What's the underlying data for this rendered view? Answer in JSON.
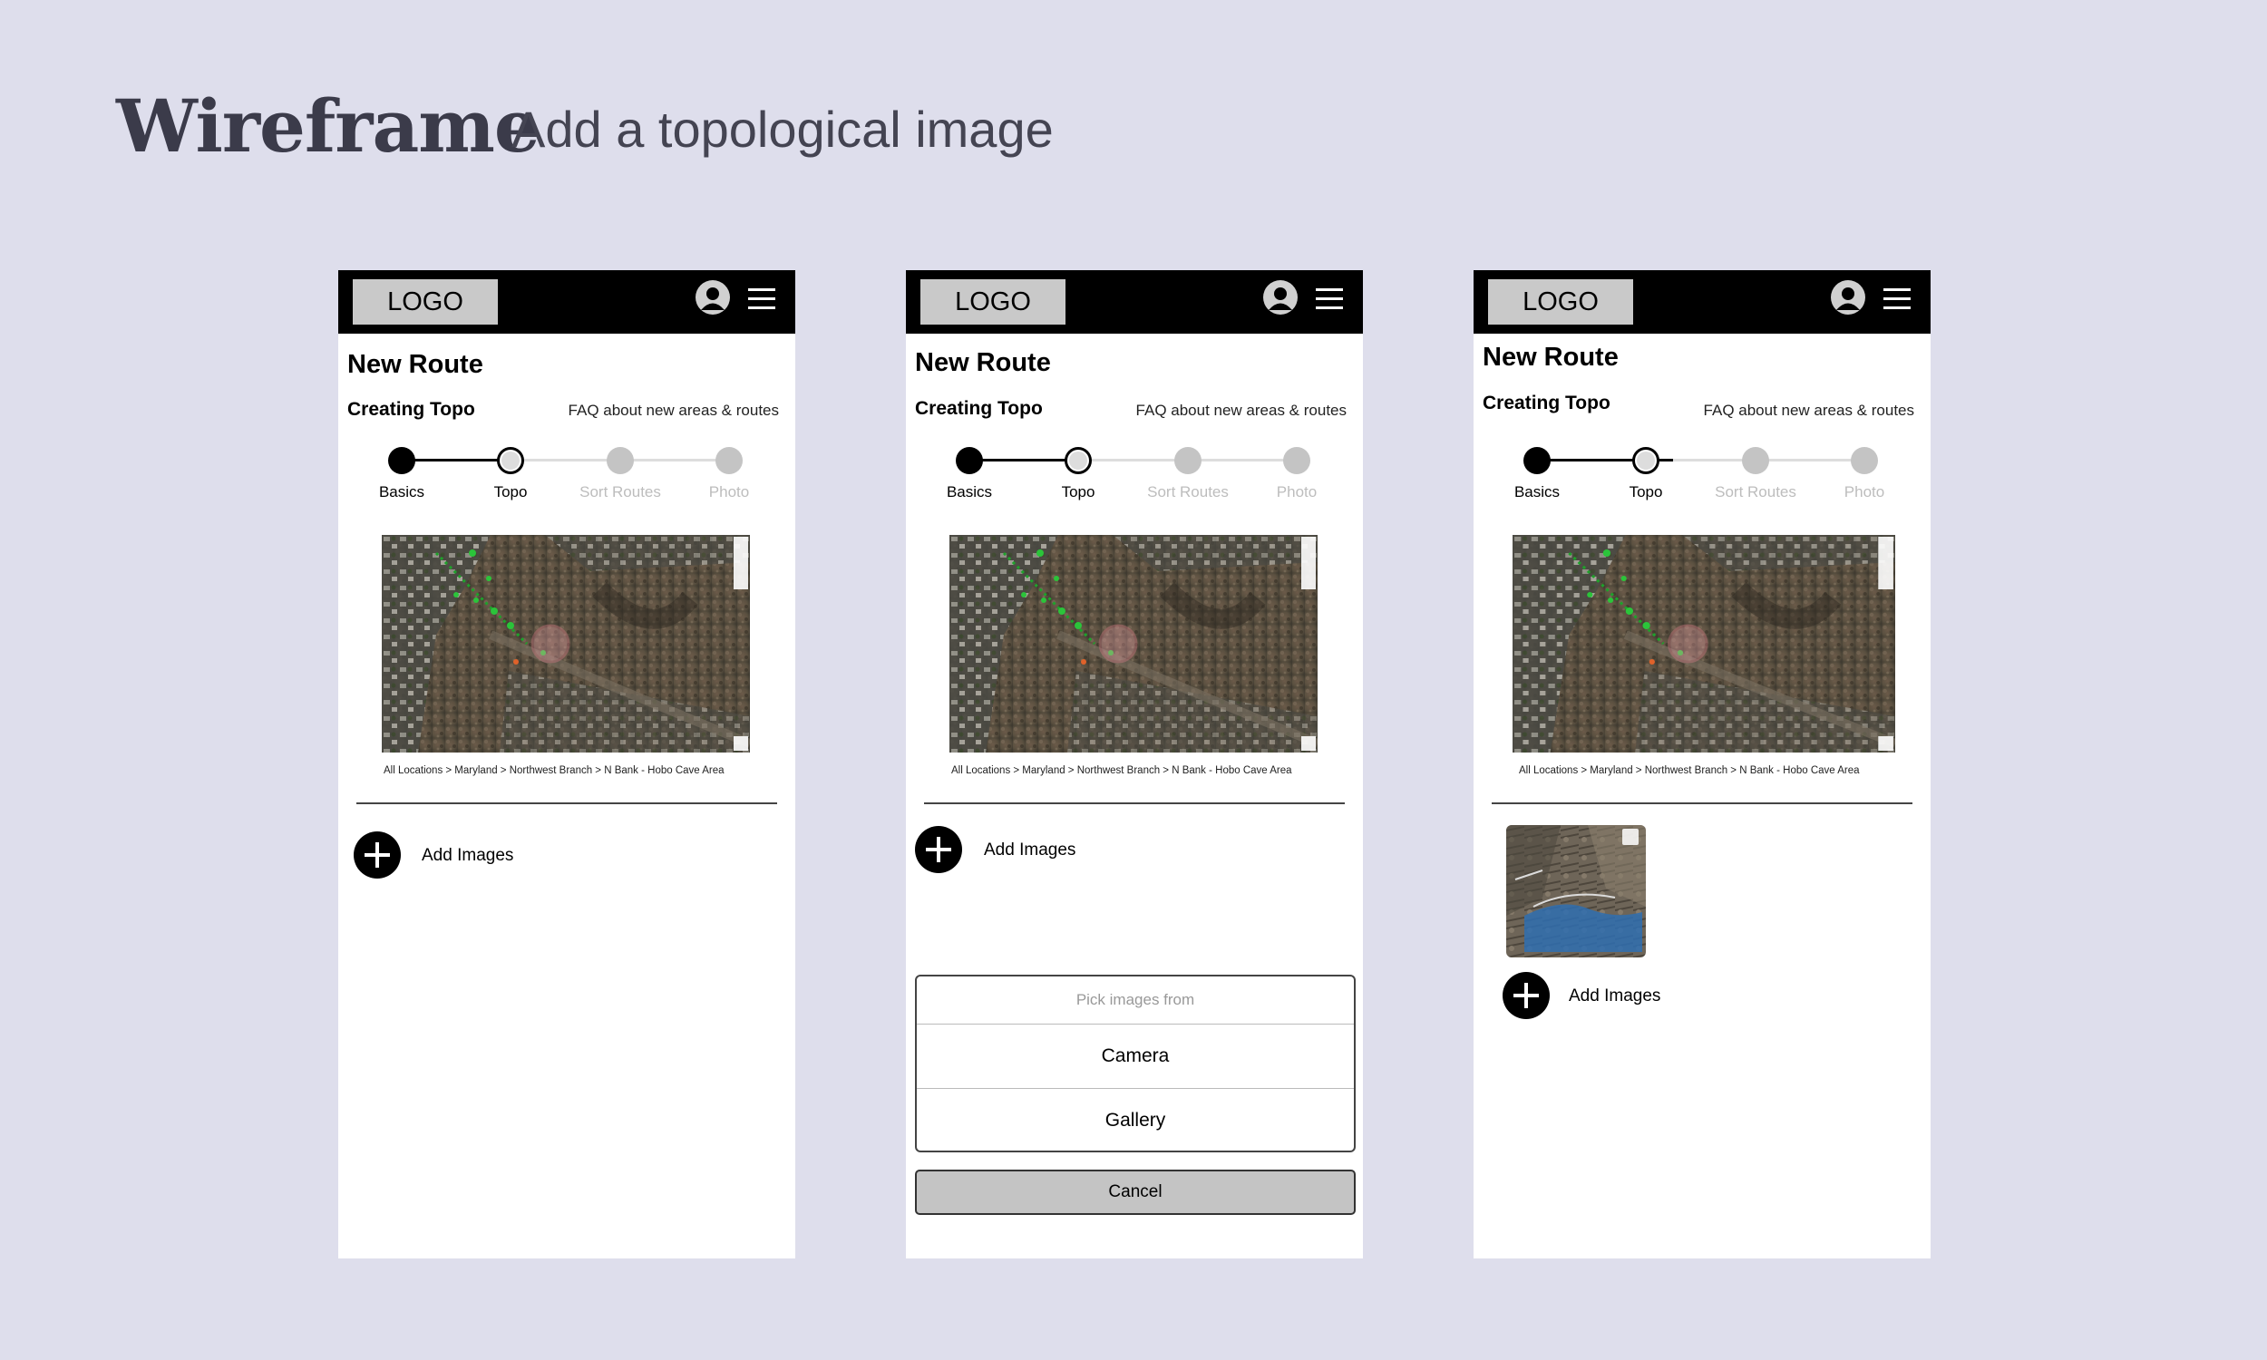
{
  "heading": {
    "title": "Wireframe",
    "subtitle": "Add a topological image"
  },
  "screens": [
    {
      "logo": "LOGO",
      "title": "New Route",
      "section": "Creating Topo",
      "faq_link": "FAQ about new areas & routes",
      "steps": [
        "Basics",
        "Topo",
        "Sort Routes",
        "Photo"
      ],
      "breadcrumb": "All Locations > Maryland > Northwest Branch > N Bank - Hobo Cave Area",
      "add_images_label": "Add Images"
    },
    {
      "logo": "LOGO",
      "title": "New Route",
      "section": "Creating Topo",
      "faq_link": "FAQ about new areas & routes",
      "steps": [
        "Basics",
        "Topo",
        "Sort Routes",
        "Photo"
      ],
      "breadcrumb": "All Locations > Maryland > Northwest Branch > N Bank - Hobo Cave Area",
      "add_images_label": "Add Images",
      "picker": {
        "header": "Pick images from",
        "options": [
          "Camera",
          "Gallery"
        ],
        "cancel": "Cancel"
      }
    },
    {
      "logo": "LOGO",
      "title": "New Route",
      "section": "Creating Topo",
      "faq_link": "FAQ about new areas & routes",
      "steps": [
        "Basics",
        "Topo",
        "Sort Routes",
        "Photo"
      ],
      "breadcrumb": "All Locations > Maryland > Northwest Branch > N Bank - Hobo Cave Area",
      "add_images_label": "Add Images"
    }
  ],
  "icons": {
    "avatar": "user-avatar-icon",
    "menu": "hamburger-menu-icon",
    "add": "plus-circle-icon",
    "map_layers": "layers-icon",
    "zoom": "map-zoom-controls-icon"
  },
  "colors": {
    "background": "#dedeec",
    "appbar": "#000000",
    "step_inactive": "#c4c4c4"
  }
}
